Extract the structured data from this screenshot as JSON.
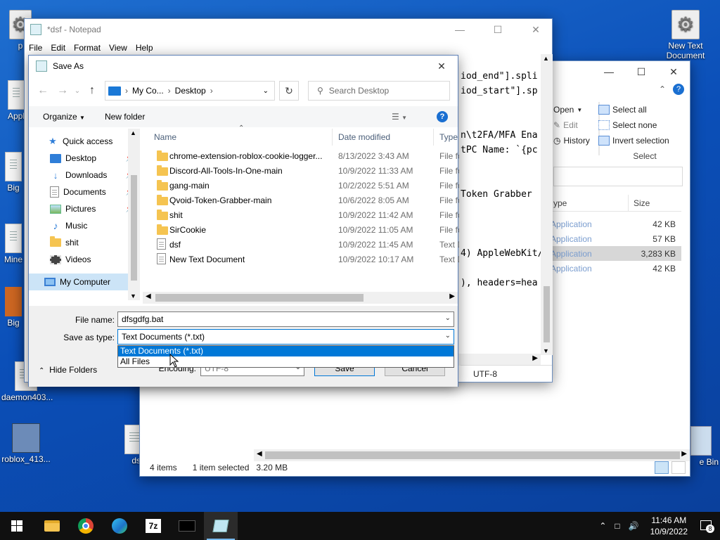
{
  "desktop": {
    "icons": [
      {
        "label": "New Text Document"
      },
      {
        "label": "daemon403..."
      },
      {
        "label": "roblox_413..."
      },
      {
        "label": "Big"
      },
      {
        "label": "Mine"
      },
      {
        "label": "Appl"
      },
      {
        "label": "p"
      },
      {
        "label": "ds"
      },
      {
        "label": "e Bin"
      }
    ]
  },
  "explorer": {
    "ribbon": {
      "open": "Open",
      "edit": "Edit",
      "history": "History",
      "select_all": "Select all",
      "select_none": "Select none",
      "invert_selection": "Invert selection",
      "group_select": "Select"
    },
    "columns": {
      "type": "ype",
      "size": "Size"
    },
    "rows": [
      {
        "type": "Application",
        "size": "42 KB"
      },
      {
        "type": "Application",
        "size": "57 KB"
      },
      {
        "type": "Application",
        "size": "3,283 KB"
      },
      {
        "type": "Application",
        "size": "42 KB"
      }
    ],
    "status": {
      "items": "4 items",
      "selected": "1 item selected",
      "size": "3.20 MB"
    }
  },
  "notepad": {
    "title": "*dsf - Notepad",
    "menu": [
      "File",
      "Edit",
      "Format",
      "View",
      "Help"
    ],
    "text_lines": [
      "",
      "iod_end\"].spli",
      "iod_start\"].sp",
      "",
      "",
      "n\\t2FA/MFA Ena",
      "tPC Name: `{pc",
      "",
      "",
      "Token Grabber",
      "",
      "",
      "",
      "4) AppleWebKit/",
      "",
      "), headers=hea"
    ],
    "encoding_status": "UTF-8"
  },
  "saveas": {
    "title": "Save As",
    "breadcrumb": [
      "My Co...",
      "Desktop"
    ],
    "search_placeholder": "Search Desktop",
    "organize": "Organize",
    "new_folder": "New folder",
    "nav": {
      "quick_access": "Quick access",
      "items": [
        {
          "label": "Desktop"
        },
        {
          "label": "Downloads"
        },
        {
          "label": "Documents"
        },
        {
          "label": "Pictures"
        },
        {
          "label": "Music"
        },
        {
          "label": "shit"
        },
        {
          "label": "Videos"
        }
      ],
      "my_computer": "My Computer"
    },
    "columns": {
      "name": "Name",
      "date": "Date modified",
      "type": "Type"
    },
    "files": [
      {
        "name": "chrome-extension-roblox-cookie-logger...",
        "date": "8/13/2022 3:43 AM",
        "type": "File fo",
        "kind": "folder"
      },
      {
        "name": "Discord-All-Tools-In-One-main",
        "date": "10/9/2022 11:33 AM",
        "type": "File fo",
        "kind": "folder"
      },
      {
        "name": "gang-main",
        "date": "10/2/2022 5:51 AM",
        "type": "File fo",
        "kind": "folder"
      },
      {
        "name": "Qvoid-Token-Grabber-main",
        "date": "10/6/2022 8:05 AM",
        "type": "File fo",
        "kind": "folder"
      },
      {
        "name": "shit",
        "date": "10/9/2022 11:42 AM",
        "type": "File fo",
        "kind": "folder"
      },
      {
        "name": "SirCookie",
        "date": "10/9/2022 11:05 AM",
        "type": "File fo",
        "kind": "folder"
      },
      {
        "name": "dsf",
        "date": "10/9/2022 11:45 AM",
        "type": "Text D",
        "kind": "text"
      },
      {
        "name": "New Text Document",
        "date": "10/9/2022 10:17 AM",
        "type": "Text D",
        "kind": "text"
      }
    ],
    "file_name_label": "File name:",
    "file_name_value": "dfsgdfg.bat",
    "save_as_type_label": "Save as type:",
    "save_as_type_value": "Text Documents (*.txt)",
    "type_options": [
      "Text Documents (*.txt)",
      "All Files"
    ],
    "encoding_label": "Encoding:",
    "encoding_value": "UTF-8",
    "hide_folders": "Hide Folders",
    "save": "Save",
    "cancel": "Cancel"
  },
  "taskbar": {
    "time": "11:46 AM",
    "date": "10/9/2022",
    "notifications": "8",
    "app_7z": "7z"
  }
}
